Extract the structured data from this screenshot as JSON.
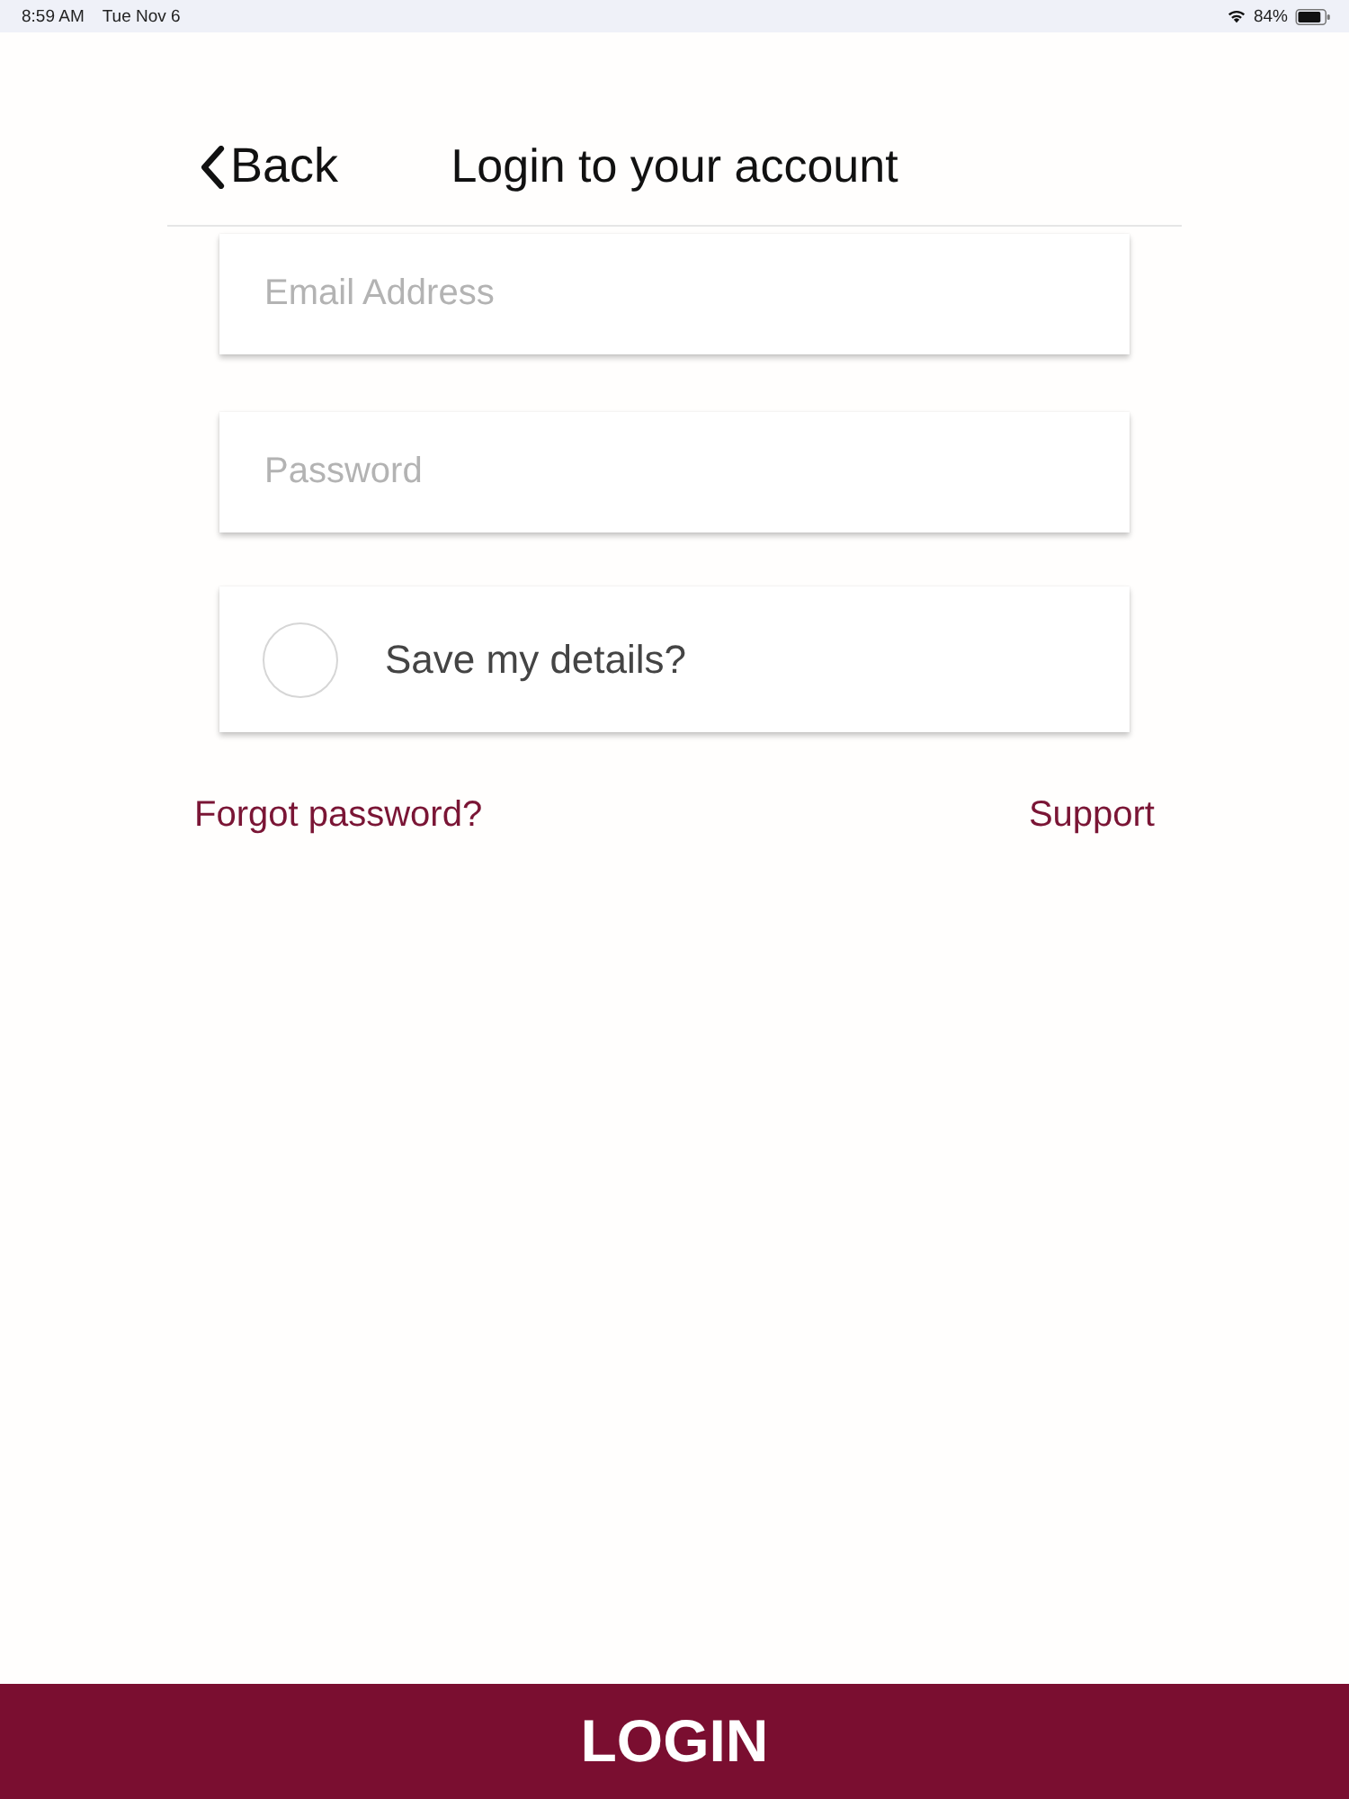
{
  "status_bar": {
    "time": "8:59 AM",
    "date": "Tue Nov 6",
    "battery": "84%"
  },
  "header": {
    "back": "Back",
    "title": "Login to your account"
  },
  "fields": [
    {
      "placeholder": "Email Address"
    },
    {
      "placeholder": "Password"
    }
  ],
  "save_details": {
    "label": "Save my details?",
    "checked": false
  },
  "links": [
    {
      "label": "Forgot password?"
    },
    {
      "label": "Support"
    }
  ],
  "login_button": {
    "label": "LOGIN"
  }
}
